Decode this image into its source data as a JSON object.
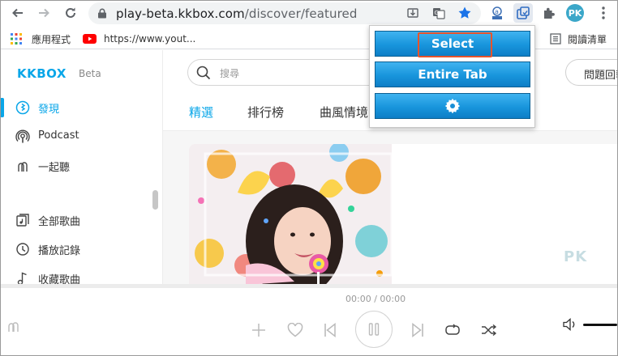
{
  "browser": {
    "url_host": "play-beta.kkbox.com",
    "url_path": "/discover/featured",
    "profile_initials": "PK",
    "bookmarks": [
      {
        "label": "應用程式",
        "icon": "apps-grid-icon"
      },
      {
        "label": "https://www.yout...",
        "icon": "youtube-icon"
      }
    ],
    "reading_list": "閱讀清單",
    "colors": {
      "star": "#1a73e8",
      "youtube": "#ff0000"
    }
  },
  "kkbox": {
    "logo": "KKBOX",
    "logo_badge": "Beta",
    "sidebar": {
      "items": [
        {
          "label": "發現",
          "icon": "discover-icon",
          "active": true
        },
        {
          "label": "Podcast",
          "icon": "podcast-icon",
          "active": false
        },
        {
          "label": "一起聽",
          "icon": "listen-together-icon",
          "active": false
        },
        {
          "label": "全部歌曲",
          "icon": "all-songs-icon",
          "active": false
        },
        {
          "label": "播放記錄",
          "icon": "history-icon",
          "active": false
        },
        {
          "label": "收藏歌曲",
          "icon": "favorite-songs-icon",
          "active": false
        }
      ]
    },
    "search": {
      "placeholder": "搜尋"
    },
    "help_button": "問題回報",
    "tabs": [
      {
        "label": "精選",
        "active": true
      },
      {
        "label": "排行榜",
        "active": false
      },
      {
        "label": "曲風情境",
        "active": false
      }
    ],
    "watermark": "PK",
    "accent": "#09a6e8"
  },
  "player": {
    "time": "00:00 / 00:00"
  },
  "popup": {
    "buttons": [
      {
        "label": "Select"
      },
      {
        "label": "Entire Tab"
      },
      {
        "label": "",
        "icon": "gear-icon"
      }
    ]
  }
}
